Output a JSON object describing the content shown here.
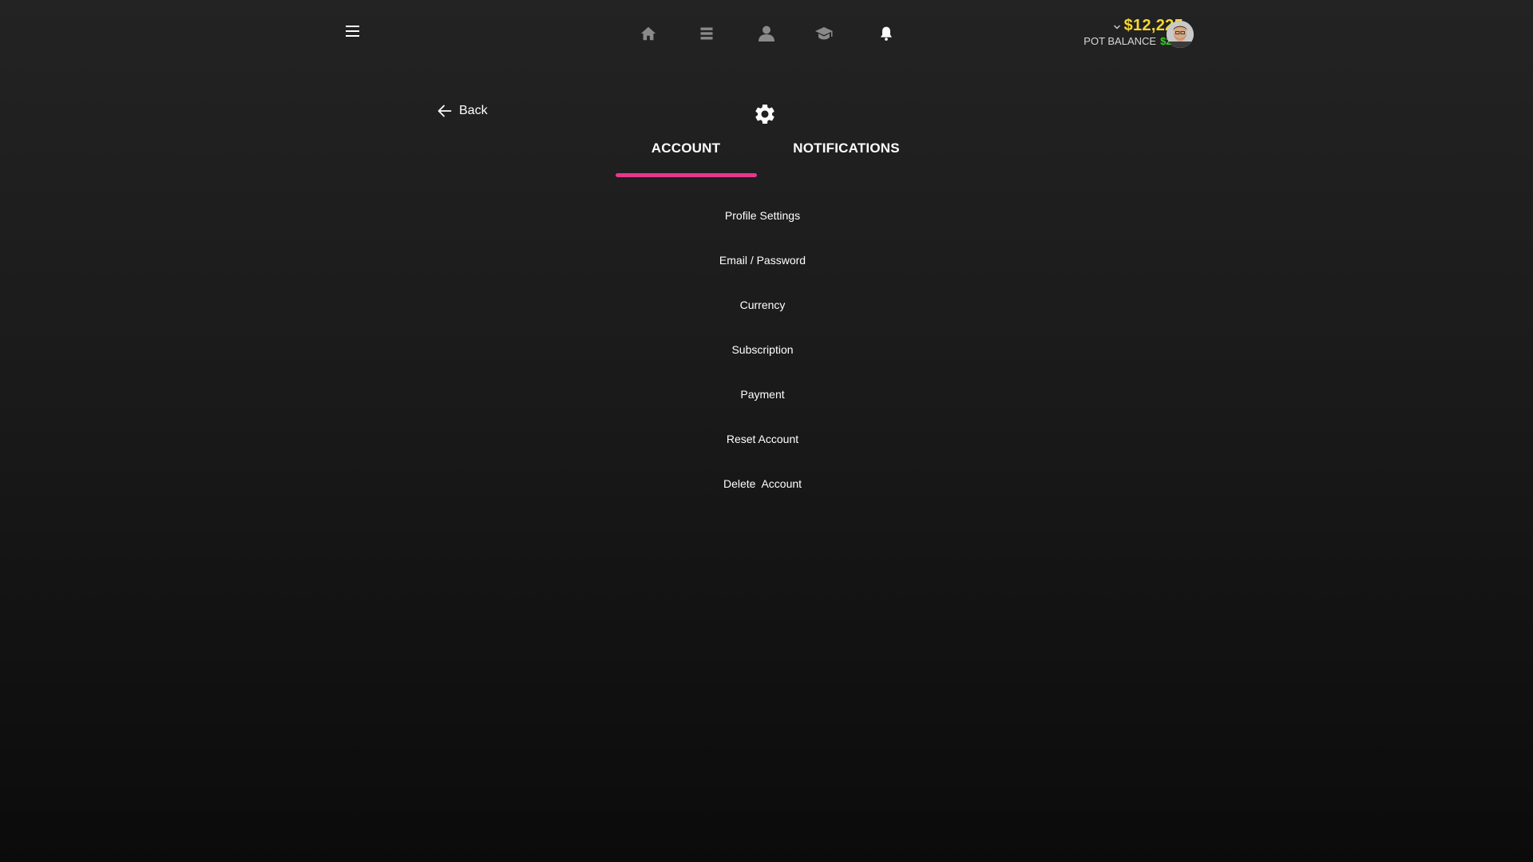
{
  "topbar": {
    "menu_icon": "hamburger-menu-icon",
    "nav": [
      {
        "icon": "home-icon"
      },
      {
        "icon": "list-icon"
      },
      {
        "icon": "user-icon"
      },
      {
        "icon": "graduation-cap-icon"
      },
      {
        "icon": "bell-icon"
      }
    ],
    "balance": {
      "amount": "$12,225",
      "pot_label": "POT BALANCE",
      "pot_amount": "$235"
    },
    "avatar_icon": "user-avatar"
  },
  "header": {
    "back_label": "Back",
    "settings_icon": "gear-icon"
  },
  "tabs": [
    {
      "label": "ACCOUNT",
      "active": true
    },
    {
      "label": "NOTIFICATIONS",
      "active": false
    }
  ],
  "menu": {
    "items": [
      {
        "label": "Profile Settings"
      },
      {
        "label": "Email / Password"
      },
      {
        "label": "Currency"
      },
      {
        "label": "Subscription"
      },
      {
        "label": "Payment"
      },
      {
        "label": "Reset Account"
      },
      {
        "label": "Delete  Account"
      }
    ]
  },
  "colors": {
    "accent": "#e8378e",
    "balance": "#f4d634",
    "pot": "#34d11f",
    "nav_icon_inactive": "#8a8a8a",
    "nav_icon_active": "#ffffff"
  }
}
